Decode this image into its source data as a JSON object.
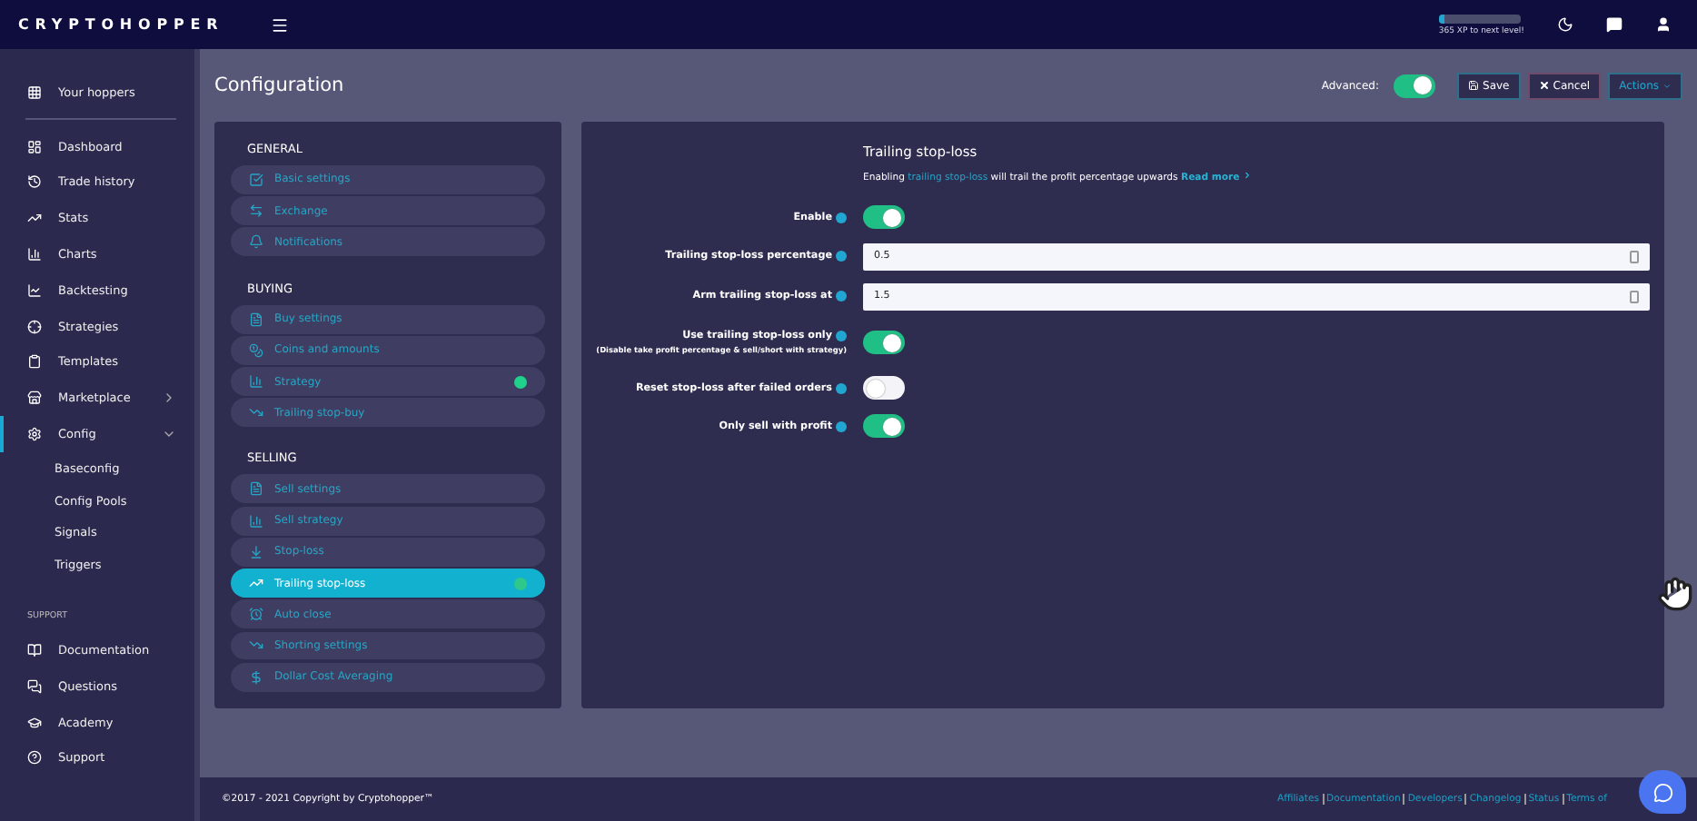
{
  "topbar": {
    "logo": "CRYPTOHOPPER",
    "xp": {
      "level": 0.08,
      "label": "365 XP to next level!"
    }
  },
  "sidebar": {
    "top_item": {
      "label": "Your hoppers"
    },
    "items": [
      {
        "label": "Dashboard",
        "selected": false
      },
      {
        "label": "Trade history",
        "selected": false
      },
      {
        "label": "Stats",
        "selected": false
      },
      {
        "label": "Charts",
        "selected": false
      },
      {
        "label": "Backtesting",
        "selected": false
      },
      {
        "label": "Strategies",
        "selected": false
      },
      {
        "label": "Templates",
        "selected": false
      },
      {
        "label": "Marketplace",
        "selected": false,
        "expanded": false
      },
      {
        "label": "Config",
        "selected": true,
        "expanded": true,
        "children": [
          {
            "label": "Baseconfig"
          },
          {
            "label": "Config Pools"
          },
          {
            "label": "Signals"
          },
          {
            "label": "Triggers"
          }
        ]
      }
    ],
    "support_heading": "SUPPORT",
    "support_items": [
      {
        "label": "Documentation"
      },
      {
        "label": "Questions"
      },
      {
        "label": "Academy"
      },
      {
        "label": "Support"
      }
    ]
  },
  "header": {
    "title": "Configuration",
    "advanced_label": "Advanced:",
    "advanced_on": true,
    "buttons": [
      {
        "label": "Save",
        "kind": "save"
      },
      {
        "label": "Cancel",
        "kind": "cancel"
      },
      {
        "label": "Actions",
        "kind": "menu"
      }
    ]
  },
  "config_menu": [
    {
      "heading": "GENERAL",
      "items": [
        {
          "label": "Basic settings",
          "selected": false,
          "dot": false
        },
        {
          "label": "Exchange",
          "selected": false,
          "dot": false
        },
        {
          "label": "Notifications",
          "selected": false,
          "dot": false
        }
      ]
    },
    {
      "heading": "BUYING",
      "items": [
        {
          "label": "Buy settings",
          "selected": false,
          "dot": false
        },
        {
          "label": "Coins and amounts",
          "selected": false,
          "dot": false
        },
        {
          "label": "Strategy",
          "selected": false,
          "dot": true
        },
        {
          "label": "Trailing stop-buy",
          "selected": false,
          "dot": false
        }
      ]
    },
    {
      "heading": "SELLING",
      "items": [
        {
          "label": "Sell settings",
          "selected": false,
          "dot": false
        },
        {
          "label": "Sell strategy",
          "selected": false,
          "dot": false
        },
        {
          "label": "Stop-loss",
          "selected": false,
          "dot": false
        },
        {
          "label": "Trailing stop-loss",
          "selected": true,
          "dot": true
        },
        {
          "label": "Auto close",
          "selected": false,
          "dot": false
        },
        {
          "label": "Shorting settings",
          "selected": false,
          "dot": false
        },
        {
          "label": "Dollar Cost Averaging",
          "selected": false,
          "dot": false
        }
      ]
    }
  ],
  "settings": {
    "title": "Trailing stop-loss",
    "description": {
      "before": "Enabling",
      "link": "trailing stop-loss",
      "after": "will trail the profit percentage upwards",
      "read_more": "Read more"
    },
    "rows": [
      {
        "kind": "toggle",
        "label": "Enable",
        "on": true
      },
      {
        "kind": "number",
        "label": "Trailing stop-loss percentage",
        "value": "0.5"
      },
      {
        "kind": "number",
        "label": "Arm trailing stop-loss at",
        "value": "1.5"
      },
      {
        "kind": "toggle",
        "label": "Use trailing stop-loss only",
        "note": "(Disable take profit percentage & sell/short with strategy)",
        "on": true
      },
      {
        "kind": "toggle",
        "label": "Reset stop-loss after failed orders",
        "on": false
      },
      {
        "kind": "toggle",
        "label": "Only sell with profit",
        "on": true
      }
    ]
  },
  "footer": {
    "copyright": "©2017 - 2021  Copyright by Cryptohopper™",
    "links": [
      "Affiliates",
      "Documentation",
      "Developers",
      "Changelog",
      "Status",
      "Terms of"
    ]
  }
}
